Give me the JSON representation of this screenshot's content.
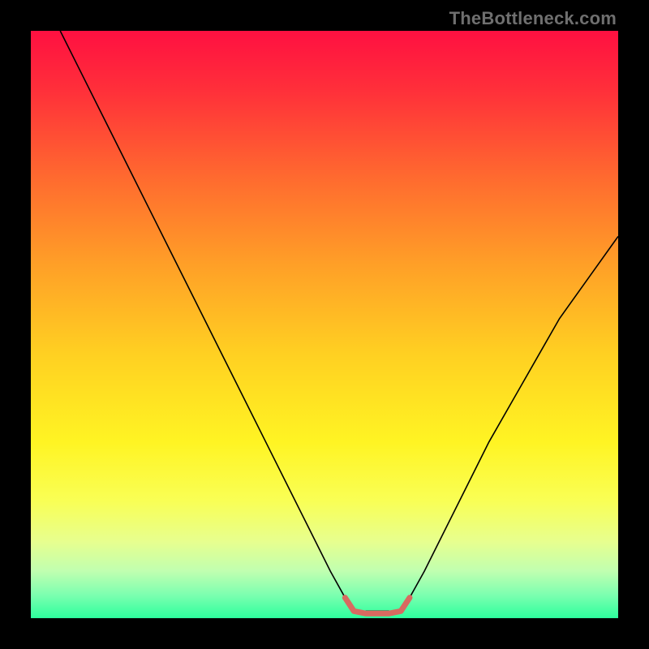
{
  "watermark": "TheBottleneck.com",
  "chart_data": {
    "type": "line",
    "title": "",
    "xlabel": "",
    "ylabel": "",
    "xlim": [
      0,
      100
    ],
    "ylim": [
      0,
      100
    ],
    "grid": false,
    "legend": false,
    "background_gradient": {
      "stops": [
        {
          "offset": 0.0,
          "color": "#ff1041"
        },
        {
          "offset": 0.1,
          "color": "#ff2f3a"
        },
        {
          "offset": 0.25,
          "color": "#ff6a2f"
        },
        {
          "offset": 0.4,
          "color": "#ffa027"
        },
        {
          "offset": 0.55,
          "color": "#ffd022"
        },
        {
          "offset": 0.7,
          "color": "#fff423"
        },
        {
          "offset": 0.8,
          "color": "#f9ff55"
        },
        {
          "offset": 0.87,
          "color": "#e7ff8f"
        },
        {
          "offset": 0.92,
          "color": "#c0ffb0"
        },
        {
          "offset": 0.96,
          "color": "#7dffb0"
        },
        {
          "offset": 1.0,
          "color": "#2dff9d"
        }
      ]
    },
    "series": [
      {
        "name": "bottleneck-curve",
        "color": "#000000",
        "width": 1.6,
        "x": [
          5,
          8,
          12,
          16,
          20,
          24,
          28,
          32,
          36,
          40,
          44,
          48,
          51,
          53.5,
          55,
          63,
          64.5,
          67,
          70,
          74,
          78,
          82,
          86,
          90,
          95,
          100
        ],
        "y": [
          100,
          94,
          86,
          78,
          70,
          62,
          54,
          46,
          38,
          30,
          22,
          14,
          8,
          3.5,
          1.2,
          1.2,
          3.5,
          8,
          14,
          22,
          30,
          37,
          44,
          51,
          58,
          65
        ]
      },
      {
        "name": "optimal-zone",
        "color": "#d86a60",
        "width": 7,
        "linecap": "round",
        "x": [
          53.5,
          55,
          57,
          59,
          61,
          63,
          64.5
        ],
        "y": [
          3.5,
          1.2,
          0.8,
          0.8,
          0.8,
          1.2,
          3.5
        ]
      }
    ]
  }
}
